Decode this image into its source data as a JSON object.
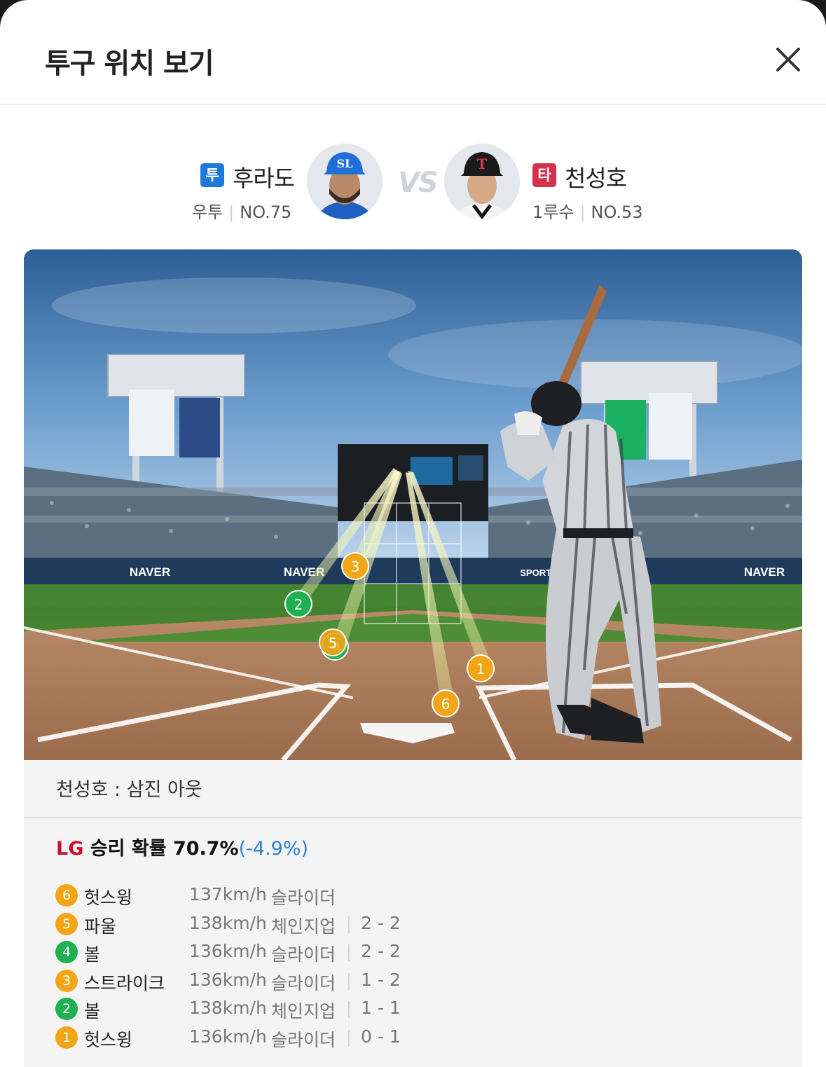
{
  "header": {
    "title": "투구 위치 보기"
  },
  "pitcher": {
    "role": "투",
    "role_color": "#1e7ad8",
    "name": "후라도",
    "hand": "우투",
    "number": "NO.75"
  },
  "vs_label": "VS",
  "batter": {
    "role": "타",
    "role_color": "#d6314f",
    "name": "천성호",
    "position": "1루수",
    "number": "NO.53"
  },
  "field": {
    "banners": [
      "NAVER",
      "SPORTS"
    ],
    "markers": [
      {
        "num": "3",
        "color": "#f2a516"
      },
      {
        "num": "2",
        "color": "#1fb050"
      },
      {
        "num": "5",
        "color": "#f2a516"
      },
      {
        "num": "4",
        "color": "#1fb050"
      },
      {
        "num": "1",
        "color": "#f2a516"
      },
      {
        "num": "6",
        "color": "#f2a516"
      }
    ]
  },
  "result": {
    "summary": "천성호 : 삼진 아웃",
    "win_team": "LG",
    "win_label": "승리 확률 70.7%",
    "win_delta": "(-4.9%)"
  },
  "pitches": [
    {
      "num": "6",
      "color": "#f2a516",
      "result": "헛스윙",
      "speed": "137km/h",
      "type": "슬라이더",
      "count": ""
    },
    {
      "num": "5",
      "color": "#f2a516",
      "result": "파울",
      "speed": "138km/h",
      "type": "체인지업",
      "count": "2 - 2"
    },
    {
      "num": "4",
      "color": "#1fb050",
      "result": "볼",
      "speed": "136km/h",
      "type": "슬라이더",
      "count": "2 - 2"
    },
    {
      "num": "3",
      "color": "#f2a516",
      "result": "스트라이크",
      "speed": "136km/h",
      "type": "슬라이더",
      "count": "1 - 2"
    },
    {
      "num": "2",
      "color": "#1fb050",
      "result": "볼",
      "speed": "138km/h",
      "type": "체인지업",
      "count": "1 - 1"
    },
    {
      "num": "1",
      "color": "#f2a516",
      "result": "헛스윙",
      "speed": "136km/h",
      "type": "슬라이더",
      "count": "0 - 1"
    }
  ]
}
